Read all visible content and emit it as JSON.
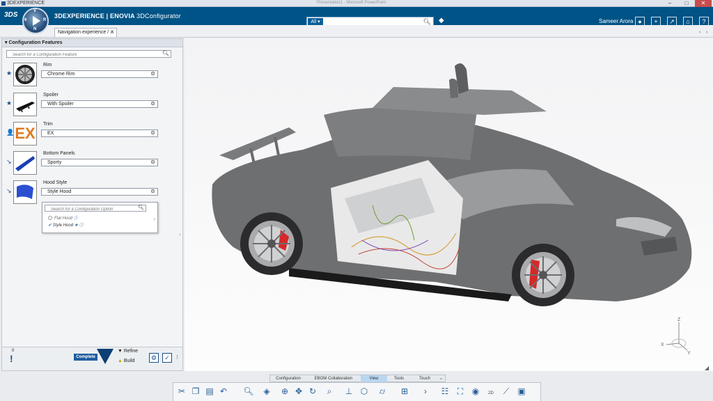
{
  "window": {
    "title": "3DEXPERIENCE",
    "center_text": "Presentation1 - Microsoft PowerPoint",
    "controls": [
      "–",
      "□",
      "✕"
    ]
  },
  "appbar": {
    "brand_glyph": "3DS",
    "title_bold": "3DEXPERIENCE | ENOVIA",
    "title_thin": "3DConfigurator",
    "search_scope": "All",
    "search_value": "",
    "user_name": "Sameer Arora",
    "compass_quadrants": [
      "V",
      "R",
      "N",
      "6"
    ]
  },
  "tabs": [
    {
      "label": "Navigation experience / ..."
    }
  ],
  "panel": {
    "header": "Configuration Features",
    "search_placeholder": "Search for a Configuration Feature",
    "features": [
      {
        "name": "Rim",
        "value": "Chrome Rim",
        "mark": "★"
      },
      {
        "name": "Spoiler",
        "value": "With Spoiler",
        "mark": "★"
      },
      {
        "name": "Trim",
        "value": "EX",
        "mark": "👤",
        "thumb_text": "EX"
      },
      {
        "name": "Bottom Panels",
        "value": "Sporty",
        "mark": "↘"
      },
      {
        "name": "Hood Style",
        "value": "Style Hood",
        "mark": "↘"
      }
    ],
    "popup": {
      "search_placeholder": "Search for a Configuration Option",
      "options": [
        {
          "label": "Flat Hood",
          "selected": false
        },
        {
          "label": "Style Hood",
          "selected": true
        }
      ]
    },
    "status": {
      "count": "0",
      "complete_label": "Complete",
      "refine_label": "Refine",
      "build_label": "Build"
    }
  },
  "bottom": {
    "tabs": [
      {
        "label": "Configuration",
        "active": false
      },
      {
        "label": "EBOM Collaboration",
        "active": false
      },
      {
        "label": "View",
        "active": true
      },
      {
        "label": "Tools",
        "active": false
      },
      {
        "label": "Touch",
        "active": false
      }
    ],
    "tools": [
      "scissors-icon",
      "copy-icon",
      "paste-icon",
      "undo-icon",
      "zoom-icon",
      "view-cube-icon",
      "fit-all-icon",
      "pan-icon",
      "rotate-icon",
      "zoom-area-icon",
      "normal-view-icon",
      "iso-view-icon",
      "cylinder-icon",
      "layout-icon",
      "next-icon",
      "tree-icon",
      "map-icon",
      "eye-icon",
      "2d3d-icon",
      "measure-icon",
      "display-icon"
    ],
    "tool_text": {
      "2d3d": "2D"
    }
  },
  "colors": {
    "appbar": "#005386",
    "accent": "#1f5d9e",
    "car_body": "#6e6f71",
    "caliper": "#d62828"
  }
}
